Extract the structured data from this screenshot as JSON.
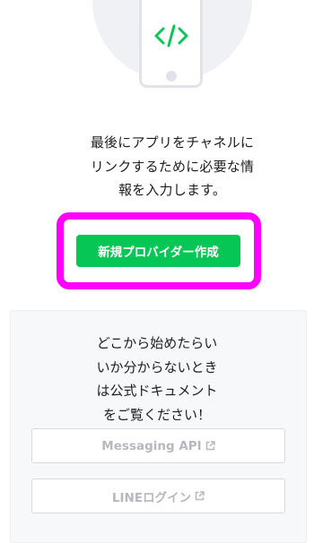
{
  "intro": {
    "lines": [
      "最後にアプリをチャネルに",
      "リンクするために必要な情",
      "報を入力します。"
    ]
  },
  "create_button": {
    "label": "新規プロバイダー作成"
  },
  "help": {
    "lines": [
      "どこから始めたらい",
      "いか分からないとき",
      "は公式ドキュメント",
      "をご覧ください！"
    ],
    "links": [
      {
        "label": "Messaging API",
        "icon": "external-link-icon"
      },
      {
        "label": "LINEログイン",
        "icon": "external-link-icon"
      }
    ]
  },
  "colors": {
    "brand_green": "#06c755",
    "highlight": "#ff00ff",
    "link_text": "#b5b8bf"
  },
  "icons": {
    "hero": "phone-code-icon"
  }
}
